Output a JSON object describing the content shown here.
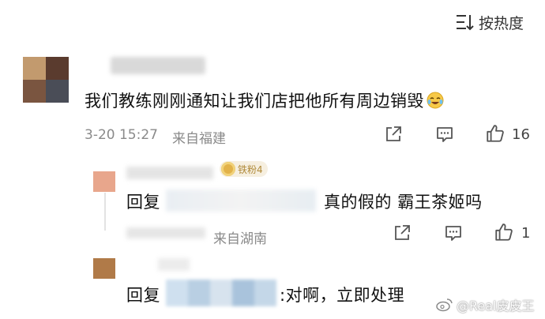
{
  "sort": {
    "label": "按热度",
    "icon": "sort-lines-icon"
  },
  "comment": {
    "text": "我们教练刚刚通知让我们店把他所有周边销毁",
    "emoji": "laughing-crying-emoji",
    "time": "3-20 15:27",
    "location": "来自福建",
    "likes": "16"
  },
  "replies": [
    {
      "badge": "铁粉4",
      "prefix": "回复",
      "text": "真的假的 霸王茶姬吗",
      "time": "",
      "location": "来自湖南",
      "likes": "1"
    },
    {
      "prefix": "回复",
      "text": ":对啊，立即处理"
    }
  ],
  "watermark": "@Real皮皮王",
  "colors": {
    "text": "#111111",
    "meta": "#8a8a8a",
    "icon": "#555555",
    "badge_bg": "#f6efe0",
    "badge_text": "#b08a3a"
  }
}
